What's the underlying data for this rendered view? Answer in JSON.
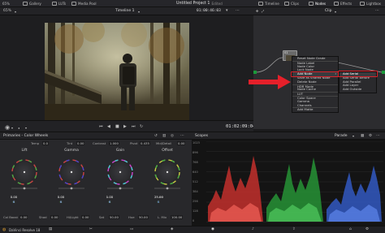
{
  "topbar": {
    "zoom": "65%",
    "tabs_left": [
      {
        "label": "Gallery",
        "icon": "gallery-icon"
      },
      {
        "label": "LUTs",
        "icon": "luts-icon"
      },
      {
        "label": "Media Pool",
        "icon": "media-pool-icon"
      }
    ],
    "project_title": "Untitled Project 1",
    "project_status": "Edited",
    "tabs_right": [
      {
        "label": "Timeline",
        "icon": "timeline-icon"
      },
      {
        "label": "Clips",
        "icon": "clips-icon"
      },
      {
        "label": "Nodes",
        "icon": "nodes-icon"
      },
      {
        "label": "Effects",
        "icon": "effects-icon"
      },
      {
        "label": "Lightbox",
        "icon": "lightbox-icon"
      }
    ]
  },
  "viewer": {
    "zoom": "65%",
    "timeline_name": "Timeline 1",
    "timecode": "01:00:46:03"
  },
  "transport": {
    "current_timecode": "01:02:09:04",
    "progress_fraction": 0.32
  },
  "node_editor": {
    "mode": "Clip",
    "node_label": "01",
    "context_menu": [
      "Reset Node Grade",
      "Node Label",
      "Node Color",
      "Lock Node",
      "Add Node",
      "Save as Shared Node",
      "Delete Node",
      "HDR Mode",
      "Node Cache",
      "LUT",
      "Color Space",
      "Gamma",
      "Channels",
      "Add Matte"
    ],
    "highlighted_item": "Add Node",
    "submenu": [
      "Add Serial",
      "Add Serial Before",
      "Add Parallel",
      "Add Layer",
      "Add Outside"
    ],
    "highlighted_submenu_item": "Add Serial",
    "colors": {
      "highlight": "#d8222a",
      "arrow": "#e5202a"
    }
  },
  "primaries": {
    "title": "Primaries - Color Wheels",
    "params": [
      {
        "label": "Temp",
        "value": "0.0"
      },
      {
        "label": "Tint",
        "value": "0.00"
      },
      {
        "label": "Contrast",
        "value": "1.000"
      },
      {
        "label": "Pivot",
        "value": "0.435"
      },
      {
        "label": "Mid/Detail",
        "value": "0.00"
      }
    ],
    "wheels": [
      {
        "label": "Lift",
        "values": [
          "0.00",
          "0.00",
          "0.00",
          "0.00"
        ],
        "color_letters": [
          "Y",
          "R",
          "G",
          "B"
        ]
      },
      {
        "label": "Gamma",
        "values": [
          "0.00",
          "0.00",
          "0.00",
          "0.00"
        ],
        "color_letters": [
          "Y",
          "R",
          "G",
          "B"
        ]
      },
      {
        "label": "Gain",
        "values": [
          "1.00",
          "1.00",
          "1.00",
          "1.00"
        ],
        "color_letters": [
          "Y",
          "R",
          "G",
          "B"
        ]
      },
      {
        "label": "Offset",
        "values": [
          "25.00",
          "25.00",
          "25.00"
        ],
        "color_letters": [
          "R",
          "G",
          "B"
        ]
      }
    ],
    "bottom_params": [
      {
        "label": "Col Boost",
        "value": "0.00"
      },
      {
        "label": "Shad",
        "value": "0.00"
      },
      {
        "label": "Hi/Light",
        "value": "0.00"
      },
      {
        "label": "Sat",
        "value": "50.00"
      },
      {
        "label": "Hue",
        "value": "50.00"
      },
      {
        "label": "L. Mix",
        "value": "100.00"
      }
    ]
  },
  "scopes": {
    "title": "Scopes",
    "mode": "Parade",
    "scale": [
      "1023",
      "896",
      "768",
      "640",
      "512",
      "384",
      "256",
      "128",
      "0"
    ]
  },
  "bottombar": {
    "app_name": "DaVinci Resolve 18"
  }
}
